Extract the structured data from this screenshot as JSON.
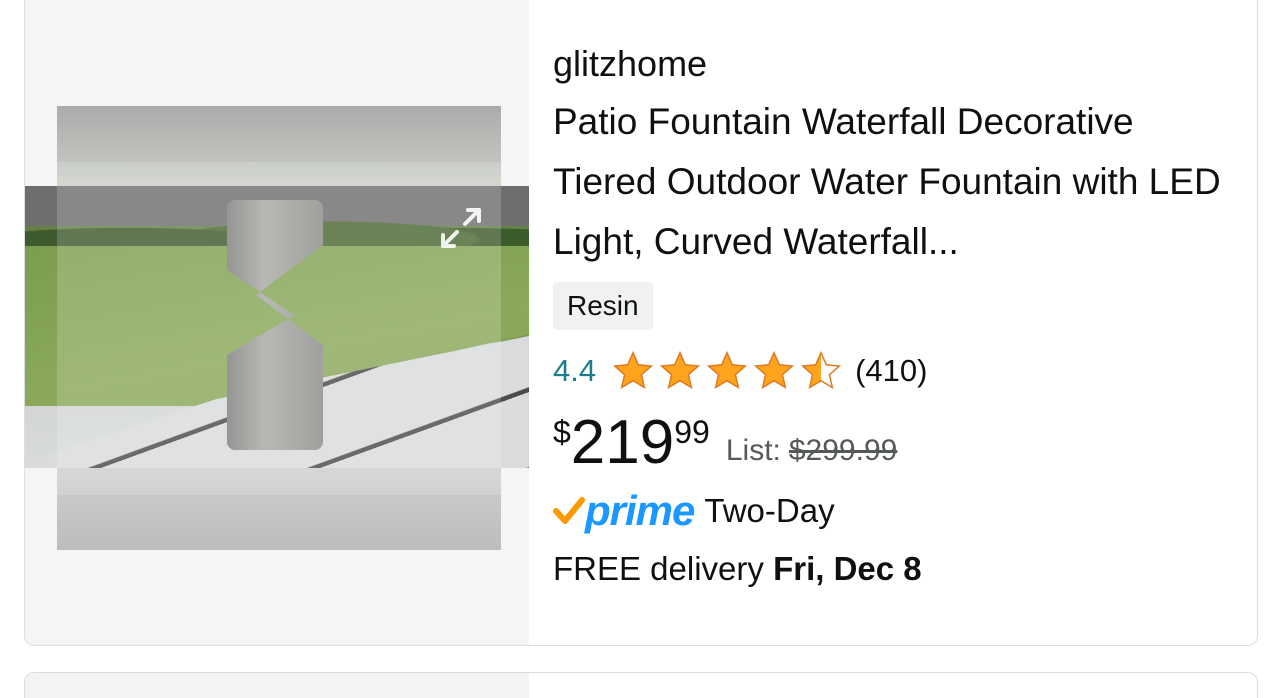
{
  "product": {
    "brand": "glitzhome",
    "title": "Patio Fountain Waterfall Decorative Tiered Outdoor Water Fountain with LED Light, Curved Waterfall...",
    "material_tag": "Resin",
    "rating": {
      "value": "4.4",
      "stars_filled_fraction": 0.88,
      "count": "(410)"
    },
    "price": {
      "symbol": "$",
      "whole": "219",
      "fraction": "99",
      "list_label": "List:",
      "list_price": "$299.99"
    },
    "prime": {
      "logo_text": "prime",
      "shipping_label": "Two-Day"
    },
    "delivery": {
      "prefix": "FREE delivery",
      "date": "Fri, Dec 8"
    },
    "image": {
      "alt_icon": "expand-icon"
    }
  },
  "colors": {
    "rating_teal": "#1b7e89",
    "star_orange": "#ffa41c",
    "prime_blue": "#1a98ff",
    "prime_check": "#ff9900",
    "text_dark": "#0f1111",
    "muted": "#565959"
  }
}
